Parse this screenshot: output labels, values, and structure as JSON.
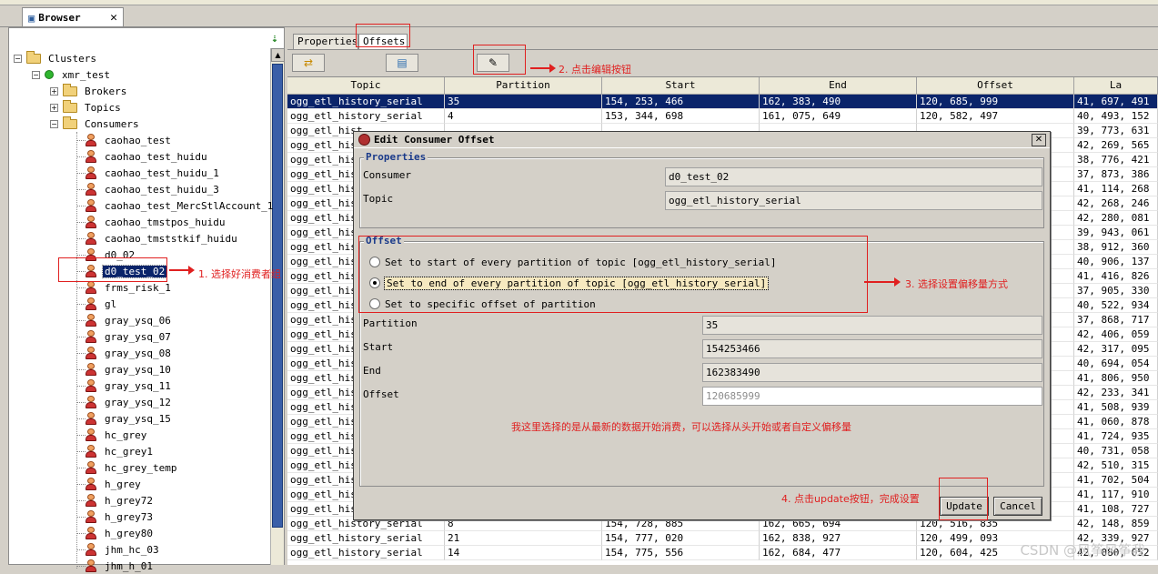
{
  "browser_tab": {
    "label": "Browser",
    "close": "✕"
  },
  "tree": {
    "clusters_label": "Clusters",
    "cluster_name": "xmr_test",
    "brokers_label": "Brokers",
    "topics_label": "Topics",
    "consumers_label": "Consumers",
    "consumers": [
      "caohao_test",
      "caohao_test_huidu",
      "caohao_test_huidu_1",
      "caohao_test_huidu_3",
      "caohao_test_MercStlAccount_1",
      "caohao_tmstpos_huidu",
      "caohao_tmststkif_huidu",
      "d0_02",
      "d0_test_02",
      "frms_risk_1",
      "gl",
      "gray_ysq_06",
      "gray_ysq_07",
      "gray_ysq_08",
      "gray_ysq_10",
      "gray_ysq_11",
      "gray_ysq_12",
      "gray_ysq_15",
      "hc_grey",
      "hc_grey1",
      "hc_grey_temp",
      "h_grey",
      "h_grey72",
      "h_grey73",
      "h_grey80",
      "jhm_hc_03",
      "jhm_h_01"
    ],
    "selected_consumer": "d0_test_02"
  },
  "right": {
    "tabs": [
      "Properties",
      "Offsets"
    ],
    "table": {
      "columns": [
        "Topic",
        "Partition",
        "Start",
        "End",
        "Offset",
        "La"
      ],
      "rows": [
        [
          "ogg_etl_history_serial",
          "35",
          "154, 253, 466",
          "162, 383, 490",
          "120, 685, 999",
          "41, 697, 491"
        ],
        [
          "ogg_etl_history_serial",
          "4",
          "153, 344, 698",
          "161, 075, 649",
          "120, 582, 497",
          "40, 493, 152"
        ],
        [
          "ogg_etl_hist",
          "",
          "",
          "",
          "",
          "39, 773, 631"
        ],
        [
          "ogg_etl_hist",
          "",
          "",
          "",
          "",
          "42, 269, 565"
        ],
        [
          "ogg_etl_hist",
          "",
          "",
          "",
          "",
          "38, 776, 421"
        ],
        [
          "ogg_etl_hist",
          "",
          "",
          "",
          "",
          "37, 873, 386"
        ],
        [
          "ogg_etl_hist",
          "",
          "",
          "",
          "",
          "41, 114, 268"
        ],
        [
          "ogg_etl_hist",
          "",
          "",
          "",
          "",
          "42, 268, 246"
        ],
        [
          "ogg_etl_hist",
          "",
          "",
          "",
          "",
          "42, 280, 081"
        ],
        [
          "ogg_etl_hist",
          "",
          "",
          "",
          "",
          "39, 943, 061"
        ],
        [
          "ogg_etl_hist",
          "",
          "",
          "",
          "",
          "38, 912, 360"
        ],
        [
          "ogg_etl_hist",
          "",
          "",
          "",
          "",
          "40, 906, 137"
        ],
        [
          "ogg_etl_hist",
          "",
          "",
          "",
          "",
          "41, 416, 826"
        ],
        [
          "ogg_etl_hist",
          "",
          "",
          "",
          "",
          "37, 905, 330"
        ],
        [
          "ogg_etl_hist",
          "",
          "",
          "",
          "",
          "40, 522, 934"
        ],
        [
          "ogg_etl_hist",
          "",
          "",
          "",
          "",
          "37, 868, 717"
        ],
        [
          "ogg_etl_hist",
          "",
          "",
          "",
          "",
          "42, 406, 059"
        ],
        [
          "ogg_etl_hist",
          "",
          "",
          "",
          "",
          "42, 317, 095"
        ],
        [
          "ogg_etl_hist",
          "",
          "",
          "",
          "",
          "40, 694, 054"
        ],
        [
          "ogg_etl_hist",
          "",
          "",
          "",
          "",
          "41, 806, 950"
        ],
        [
          "ogg_etl_hist",
          "",
          "",
          "",
          "",
          "42, 233, 341"
        ],
        [
          "ogg_etl_hist",
          "",
          "",
          "",
          "",
          "41, 508, 939"
        ],
        [
          "ogg_etl_hist",
          "",
          "",
          "",
          "",
          "41, 060, 878"
        ],
        [
          "ogg_etl_hist",
          "",
          "",
          "",
          "",
          "41, 724, 935"
        ],
        [
          "ogg_etl_hist",
          "",
          "",
          "",
          "",
          "40, 731, 058"
        ],
        [
          "ogg_etl_hist",
          "",
          "",
          "",
          "",
          "42, 510, 315"
        ],
        [
          "ogg_etl_hist",
          "",
          "",
          "",
          "",
          "41, 702, 504"
        ],
        [
          "ogg_etl_hist",
          "",
          "",
          "",
          "",
          "41, 117, 910"
        ],
        [
          "ogg_etl_hist",
          "",
          "",
          "",
          "",
          "41, 108, 727"
        ],
        [
          "ogg_etl_history_serial",
          "8",
          "154, 728, 885",
          "162, 665, 694",
          "120, 516, 835",
          "42, 148, 859"
        ],
        [
          "ogg_etl_history_serial",
          "21",
          "154, 777, 020",
          "162, 838, 927",
          "120, 499, 093",
          "42, 339, 927"
        ],
        [
          "ogg_etl_history_serial",
          "14",
          "154, 775, 556",
          "162, 684, 477",
          "120, 604, 425",
          "42, 080, 052"
        ]
      ]
    }
  },
  "dialog": {
    "title": "Edit Consumer Offset",
    "close": "✕",
    "properties_title": "Properties",
    "consumer_label": "Consumer",
    "consumer_value": "d0_test_02",
    "topic_label": "Topic",
    "topic_value": "ogg_etl_history_serial",
    "offset_title": "Offset",
    "radio_start": "Set to start of every partition of topic [ogg_etl_history_serial]",
    "radio_end": "Set to end of every partition of topic [ogg_etl_history_serial]",
    "radio_specific": "Set to specific offset of partition",
    "selected_option": "end",
    "partition_label": "Partition",
    "partition_value": "35",
    "start_label": "Start",
    "start_value": "154253466",
    "end_label": "End",
    "end_value": "162383490",
    "offset_label": "Offset",
    "offset_placeholder": "120685999",
    "update_label": "Update",
    "cancel_label": "Cancel"
  },
  "annotations": {
    "step1": "1. 选择好消费者组",
    "step2": "2. 点击编辑按钮",
    "step3": "3. 选择设置偏移量方式",
    "step4": "4. 点击update按钮，完成设置",
    "note": "我这里选择的是从最新的数据开始消费，可以选择从头开始或者自定义偏移量"
  },
  "watermark": "CSDN @风筝风筝我",
  "colors": {
    "selection": "#0a246a",
    "annotation": "#e02020",
    "title_blue": "#1a3a8a"
  }
}
